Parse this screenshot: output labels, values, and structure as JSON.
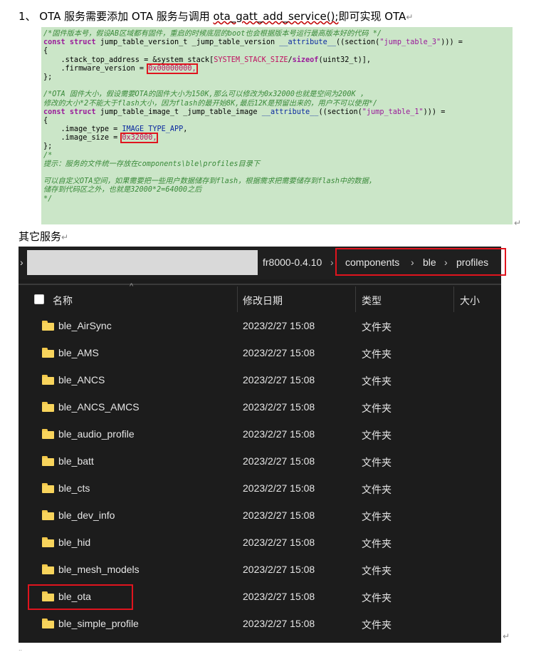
{
  "heading": {
    "prefix": "1、 OTA 服务需要添加 OTA 服务与调用 ",
    "function": "ota_gatt_add_service();",
    "suffix": "即可实现 OTA",
    "mark": "↵"
  },
  "code": {
    "l1": "/*固件版本号，假设AB区域都有固件，重启的时候底层的boot也会根据版本号运行最高版本好的代码 */",
    "l2_kw1": "const",
    "l2_kw2": "struct",
    "l2_a": " jump_table_version_t _jump_table_version ",
    "l2_attr": "__attribute__",
    "l2_b": "((section(",
    "l2_str": "\"jump_table_3\"",
    "l2_c": "))) =",
    "l3": "{",
    "l4_a": "    .stack_top_address = &system_stack[",
    "l4_m": "SYSTEM_STACK_SIZE",
    "l4_b": "/",
    "l4_k": "sizeof",
    "l4_c": "(uint32_t)],",
    "l5_a": "    .firmware_version = ",
    "l5_val": "0x00000000,",
    "l6": "};",
    "l7": "",
    "l8": "/*OTA 固件大小，假设需要OTA的固件大小为150K,那么可以修改为0x32000也就是空间为200K ，",
    "l9": "修改的大小*2不能大于flash大小，因为flash的最开始8K,最后12K是预留出来的，用户不可以使用*/",
    "l10_kw1": "const",
    "l10_kw2": "struct",
    "l10_a": " jump_table_image_t _jump_table_image ",
    "l10_attr": "__attribute__",
    "l10_b": "((section(",
    "l10_str": "\"jump_table_1\"",
    "l10_c": "))) =",
    "l11": "{",
    "l12_a": "    .image_type = ",
    "l12_m": "IMAGE_TYPE_APP",
    "l12_b": ",",
    "l13_a": "    .image_size = ",
    "l13_val": "0x32000,",
    "l14": "};",
    "l15": "/*",
    "l16": "提示：服务的文件统一存放在components\\ble\\profiles目录下",
    "l17": "",
    "l18": "可以自定义OTA空间，如果需要把一些用户数据储存到flash，根据需求把需要储存到flash中的数据，",
    "l19": "储存到代码区之外，也就是32000*2=64000之后",
    "l20": "*/",
    "mark": "↵"
  },
  "sub_label": {
    "text": "其它服务",
    "mark": "↵"
  },
  "explorer": {
    "chevron": "›",
    "path_root": "fr8000-0.4.10",
    "sep": "›",
    "crumbs": [
      "components",
      "ble",
      "profiles"
    ],
    "columns": {
      "name": "名称",
      "date": "修改日期",
      "type": "类型",
      "size": "大小"
    },
    "rows": [
      {
        "name": "ble_AirSync",
        "date": "2023/2/27 15:08",
        "type": "文件夹"
      },
      {
        "name": "ble_AMS",
        "date": "2023/2/27 15:08",
        "type": "文件夹"
      },
      {
        "name": "ble_ANCS",
        "date": "2023/2/27 15:08",
        "type": "文件夹"
      },
      {
        "name": "ble_ANCS_AMCS",
        "date": "2023/2/27 15:08",
        "type": "文件夹"
      },
      {
        "name": "ble_audio_profile",
        "date": "2023/2/27 15:08",
        "type": "文件夹"
      },
      {
        "name": "ble_batt",
        "date": "2023/2/27 15:08",
        "type": "文件夹"
      },
      {
        "name": "ble_cts",
        "date": "2023/2/27 15:08",
        "type": "文件夹"
      },
      {
        "name": "ble_dev_info",
        "date": "2023/2/27 15:08",
        "type": "文件夹"
      },
      {
        "name": "ble_hid",
        "date": "2023/2/27 15:08",
        "type": "文件夹"
      },
      {
        "name": "ble_mesh_models",
        "date": "2023/2/27 15:08",
        "type": "文件夹"
      },
      {
        "name": "ble_ota",
        "date": "2023/2/27 15:08",
        "type": "文件夹"
      },
      {
        "name": "ble_simple_profile",
        "date": "2023/2/27 15:08",
        "type": "文件夹"
      }
    ]
  },
  "trailing_mark": "↵",
  "bottom_dots": "..",
  "colors": {
    "code_bg": "#cbe6c8",
    "highlight": "#e0141e",
    "explorer_bg": "#1c1c1c",
    "folder": "#f8d45c"
  }
}
